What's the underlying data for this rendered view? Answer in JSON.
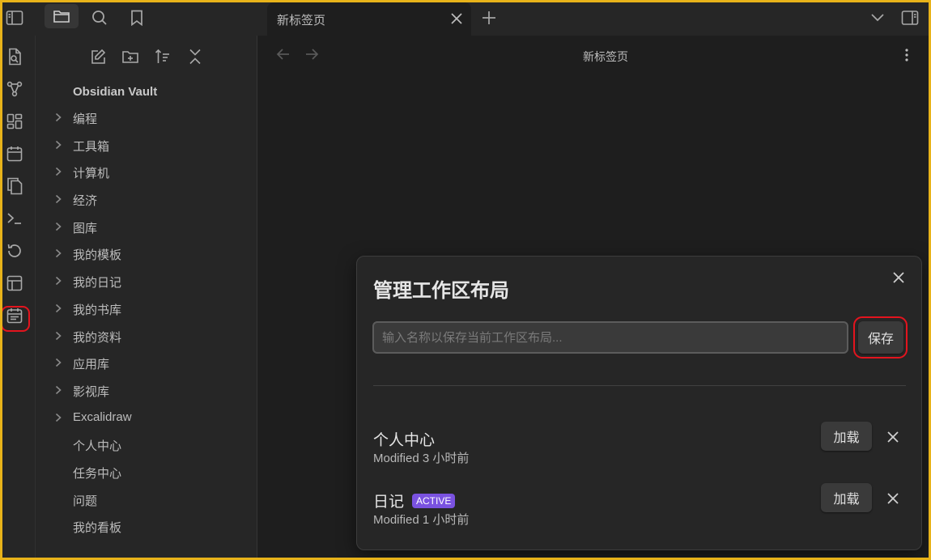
{
  "topbar": {
    "tab_title": "新标签页",
    "icons": [
      "sidebar-toggle-icon",
      "folder-icon",
      "search-icon",
      "bookmark-icon",
      "close-icon",
      "plus-icon",
      "chevron-down-icon",
      "right-sidebar-toggle-icon"
    ]
  },
  "ribbon": {
    "icons": [
      "quick-switcher-icon",
      "graph-view-icon",
      "canvas-icon",
      "daily-note-icon",
      "templates-icon",
      "command-palette-icon",
      "file-recovery-icon",
      "workspace-layouts-icon",
      "calendar-icon"
    ],
    "highlighted": "workspace-layouts-icon",
    "highlight_color": "#e3141e"
  },
  "sidebar": {
    "tools": [
      "new-note-icon",
      "new-folder-icon",
      "sort-icon",
      "collapse-all-icon"
    ],
    "vault_name": "Obsidian Vault",
    "items": [
      {
        "label": "编程",
        "folder": true
      },
      {
        "label": "工具箱",
        "folder": true
      },
      {
        "label": "计算机",
        "folder": true
      },
      {
        "label": "经济",
        "folder": true
      },
      {
        "label": "图库",
        "folder": true
      },
      {
        "label": "我的模板",
        "folder": true
      },
      {
        "label": "我的日记",
        "folder": true
      },
      {
        "label": "我的书库",
        "folder": true
      },
      {
        "label": "我的资料",
        "folder": true
      },
      {
        "label": "应用库",
        "folder": true
      },
      {
        "label": "影视库",
        "folder": true
      },
      {
        "label": "Excalidraw",
        "folder": true
      },
      {
        "label": "个人中心",
        "folder": false
      },
      {
        "label": "任务中心",
        "folder": false
      },
      {
        "label": "问题",
        "folder": false
      },
      {
        "label": "我的看板",
        "folder": false
      }
    ]
  },
  "main": {
    "view_title": "新标签页"
  },
  "modal": {
    "title": "管理工作区布局",
    "input_placeholder": "输入名称以保存当前工作区布局...",
    "input_value": "",
    "save_label": "保存",
    "layouts": [
      {
        "name": "个人中心",
        "active": false,
        "badge": "",
        "modified": "Modified 3 小时前",
        "load_label": "加载"
      },
      {
        "name": "日记",
        "active": true,
        "badge": "ACTIVE",
        "modified": "Modified 1 小时前",
        "load_label": "加载"
      }
    ],
    "accent_color": "#7a52e0"
  },
  "colors": {
    "background": "#1e1e1e",
    "panel": "#262626",
    "frame": "#e8b31a",
    "highlight": "#e3141e"
  }
}
